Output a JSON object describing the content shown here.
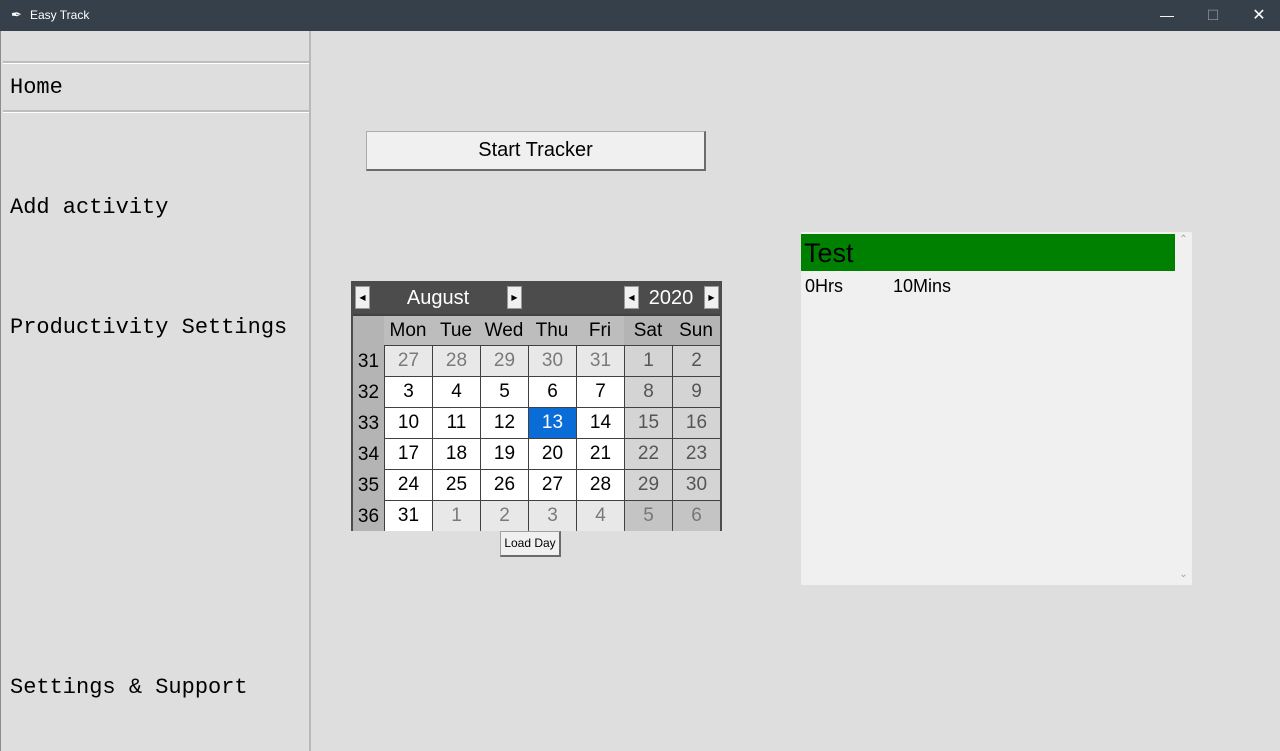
{
  "window": {
    "title": "Easy Track",
    "minimize": "—",
    "maximize": "☐",
    "close": "✕",
    "icon": "feather-icon"
  },
  "sidebar": {
    "items": [
      {
        "label": "Home"
      },
      {
        "label": "Add activity"
      },
      {
        "label": "Productivity Settings"
      },
      {
        "label": "Settings & Support"
      }
    ]
  },
  "main": {
    "start_button": "Start Tracker",
    "load_button": "Load Day"
  },
  "calendar": {
    "month": "August",
    "year": "2020",
    "prev": "◀",
    "next": "▶",
    "dow": [
      "Mon",
      "Tue",
      "Wed",
      "Thu",
      "Fri",
      "Sat",
      "Sun"
    ],
    "weeks": [
      {
        "wk": "31",
        "days": [
          "27",
          "28",
          "29",
          "30",
          "31",
          "1",
          "2"
        ]
      },
      {
        "wk": "32",
        "days": [
          "3",
          "4",
          "5",
          "6",
          "7",
          "8",
          "9"
        ]
      },
      {
        "wk": "33",
        "days": [
          "10",
          "11",
          "12",
          "13",
          "14",
          "15",
          "16"
        ]
      },
      {
        "wk": "34",
        "days": [
          "17",
          "18",
          "19",
          "20",
          "21",
          "22",
          "23"
        ]
      },
      {
        "wk": "35",
        "days": [
          "24",
          "25",
          "26",
          "27",
          "28",
          "29",
          "30"
        ]
      },
      {
        "wk": "36",
        "days": [
          "31",
          "1",
          "2",
          "3",
          "4",
          "5",
          "6"
        ]
      }
    ],
    "selected": "13",
    "selected_color": "#0a6cd6"
  },
  "activity_panel": {
    "name": "Test",
    "hours": "0Hrs",
    "minutes": "10Mins",
    "header_color": "#008000"
  }
}
